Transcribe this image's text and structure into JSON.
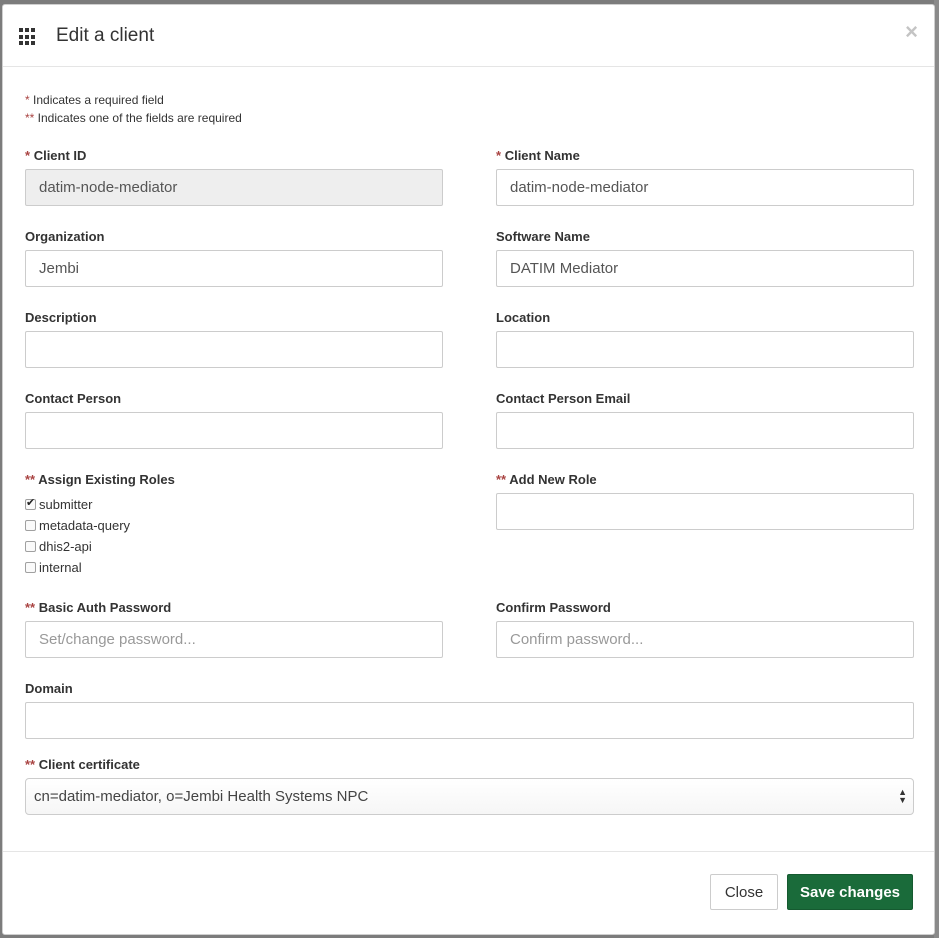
{
  "header": {
    "title": "Edit a client",
    "close_symbol": "×",
    "icon": "grid-icon"
  },
  "notes": {
    "required_star": "*",
    "required_text": " Indicates a required field",
    "one_of_star": "**",
    "one_of_text": " Indicates one of the fields are required"
  },
  "fields": {
    "client_id": {
      "star": "*",
      "label": "Client ID",
      "value": "datim-node-mediator"
    },
    "client_name": {
      "star": "*",
      "label": "Client Name",
      "value": "datim-node-mediator"
    },
    "organization": {
      "label": "Organization",
      "value": "Jembi"
    },
    "software_name": {
      "label": "Software Name",
      "value": "DATIM Mediator"
    },
    "description": {
      "label": "Description",
      "value": ""
    },
    "location": {
      "label": "Location",
      "value": ""
    },
    "contact_person": {
      "label": "Contact Person",
      "value": ""
    },
    "contact_email": {
      "label": "Contact Person Email",
      "value": ""
    },
    "add_new_role": {
      "star": "**",
      "label": "Add New Role",
      "value": ""
    },
    "basic_auth": {
      "star": "**",
      "label": "Basic Auth Password",
      "placeholder": "Set/change password..."
    },
    "confirm_password": {
      "label": "Confirm Password",
      "placeholder": "Confirm password..."
    },
    "domain": {
      "label": "Domain",
      "value": ""
    },
    "client_certificate": {
      "star": "**",
      "label": "Client certificate",
      "selected": "cn=datim-mediator, o=Jembi Health Systems NPC"
    }
  },
  "roles": {
    "star": "**",
    "label": "Assign Existing Roles",
    "items": [
      {
        "label": "submitter",
        "checked": true
      },
      {
        "label": "metadata-query",
        "checked": false
      },
      {
        "label": "dhis2-api",
        "checked": false
      },
      {
        "label": "internal",
        "checked": false
      }
    ]
  },
  "footer": {
    "close_label": "Close",
    "save_label": "Save changes"
  },
  "colors": {
    "required": "#a94442",
    "save_button": "#1a6b3a"
  }
}
